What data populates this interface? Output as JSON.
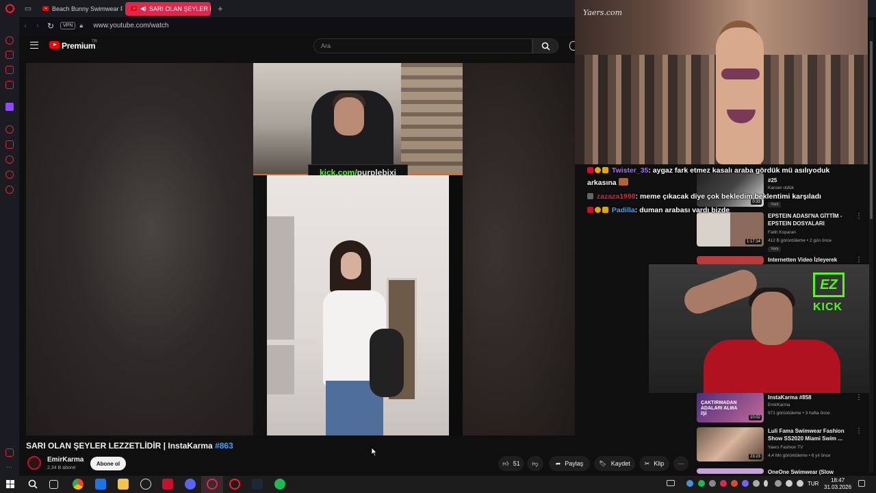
{
  "browser": {
    "tabs": [
      {
        "label": "Beach Bunny Swimwear F",
        "active": false
      },
      {
        "label": "SARI OLAN ŞEYLER LE",
        "active": true
      }
    ],
    "address": {
      "vpn": "VPN",
      "url": "www.youtube.com/watch"
    }
  },
  "youtube": {
    "brand": "Premium",
    "brand_sup": "TR",
    "search_placeholder": "Ara"
  },
  "video": {
    "overlay_kick_prefix": "kick.com/",
    "overlay_kick_user": "purplebixi",
    "title": "SARI OLAN ŞEYLER LEZZETLİDİR | InstaKarma",
    "hashtag": "#863",
    "channel": {
      "name": "EmirKarma",
      "subs": "2,34 B abone"
    },
    "subscribe_label": "Abone ol",
    "actions": {
      "likes": "51",
      "share": "Paylaş",
      "save": "Kaydet",
      "clip": "Klip"
    }
  },
  "overlay": {
    "watermark": "Yaers.com",
    "chat": [
      {
        "user": "Twister_35",
        "user_color": "#b06cff",
        "message": ": aygaz fark etmez kasalı araba gördük mü asılıyoduk"
      },
      {
        "user": "",
        "user_color": "#ffffff",
        "message": "arkasına"
      },
      {
        "user": "zazaza1998",
        "user_color": "#e0264a",
        "message": ": meme çıkacak diye çok bekledim beklentimi karşıladı"
      },
      {
        "user": "Padilla",
        "user_color": "#3ea6ff",
        "message": ": duman arabası vardı bizde"
      }
    ],
    "cam_logo": "EZ",
    "cam_kick": "KICK"
  },
  "recommendations": [
    {
      "title": "#25",
      "channel": "Kanser oldük",
      "meta": "",
      "badge": "Yeni",
      "duration": "0:33"
    },
    {
      "title": "EPSTEIN ADASI'NA GİTTİM - EPSTEIN DOSYALARI",
      "channel": "Fatih Koparan",
      "meta": "412 B görüntüleme • 2 gün önce",
      "badge": "Yeni",
      "duration": "1:17:14"
    },
    {
      "title": "Internetten Video İzleyerek",
      "channel": "",
      "meta": "",
      "badge": "",
      "duration": ""
    },
    {
      "title": "InstaKarma #858",
      "channel": "EmirKarma",
      "meta": "971 görüntüleme • 3 hafta önce",
      "badge": "",
      "duration": "10:02",
      "thumb_text": "ÇAKTIRMADAN ADALARI ALMA İŞİ"
    },
    {
      "title": "Luli Fama Swimwear Fashion Show SS2020 Miami Swim ...",
      "channel": "Yaers Fashion TV",
      "meta": "4,4 Mn görüntüleme • 6 yıl önce",
      "badge": "",
      "duration": "23:23"
    },
    {
      "title": "OneOne Swimwear (Slow",
      "channel": "",
      "meta": "",
      "badge": "",
      "duration": ""
    }
  ],
  "taskbar": {
    "lang": "TUR",
    "time": "18:47",
    "date": "31.03.2026"
  },
  "colors": {
    "accent": "#e0264a",
    "youtube_red": "#ff0000",
    "kick_green": "#53fc18",
    "link_blue": "#3ea6ff"
  }
}
